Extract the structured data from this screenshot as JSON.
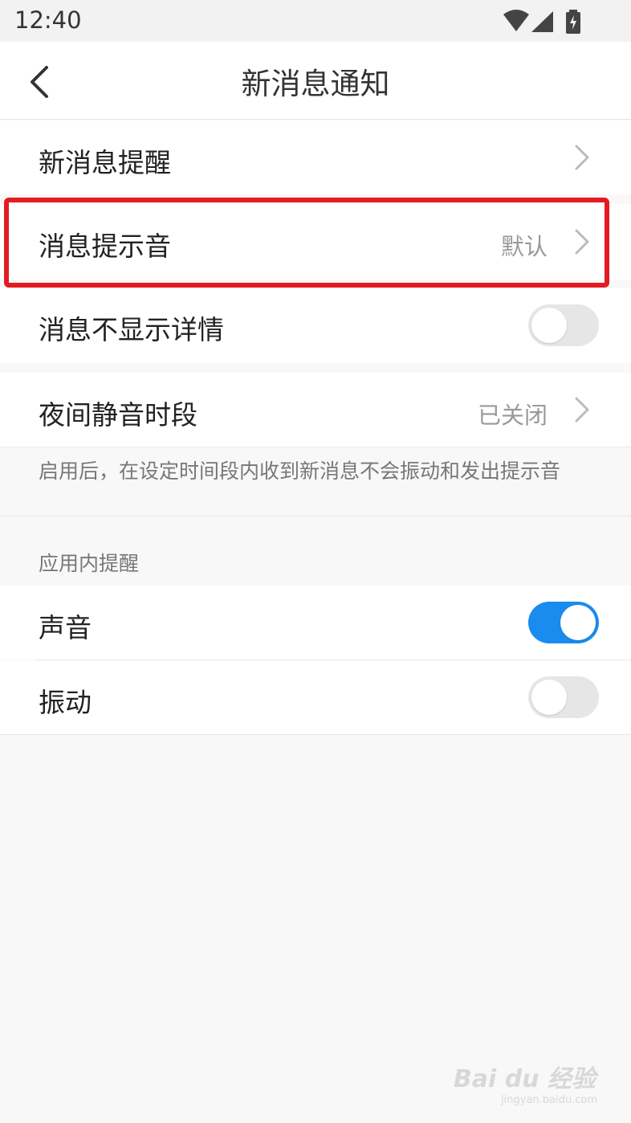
{
  "status_bar": {
    "time": "12:40",
    "icons": [
      "wifi-icon",
      "cell-signal-icon",
      "battery-charging-icon"
    ]
  },
  "header": {
    "title": "新消息通知",
    "back_icon": "back-arrow-icon"
  },
  "settings": {
    "new_message_reminder": {
      "label": "新消息提醒"
    },
    "message_sound": {
      "label": "消息提示音",
      "value": "默认"
    },
    "hide_details": {
      "label": "消息不显示详情",
      "enabled": false
    },
    "quiet_hours": {
      "label": "夜间静音时段",
      "value": "已关闭"
    },
    "quiet_hours_note": "启用后，在设定时间段内收到新消息不会振动和发出提示音"
  },
  "in_app_section": {
    "title": "应用内提醒",
    "sound": {
      "label": "声音",
      "enabled": true
    },
    "vibration": {
      "label": "振动",
      "enabled": false
    }
  },
  "colors": {
    "toggle_on": "#1a8cf0",
    "toggle_off": "#e6e6e6",
    "highlight": "#e31b23"
  },
  "watermark": {
    "text": "Bai du 经验",
    "sub": "jingyan.baidu.com"
  }
}
